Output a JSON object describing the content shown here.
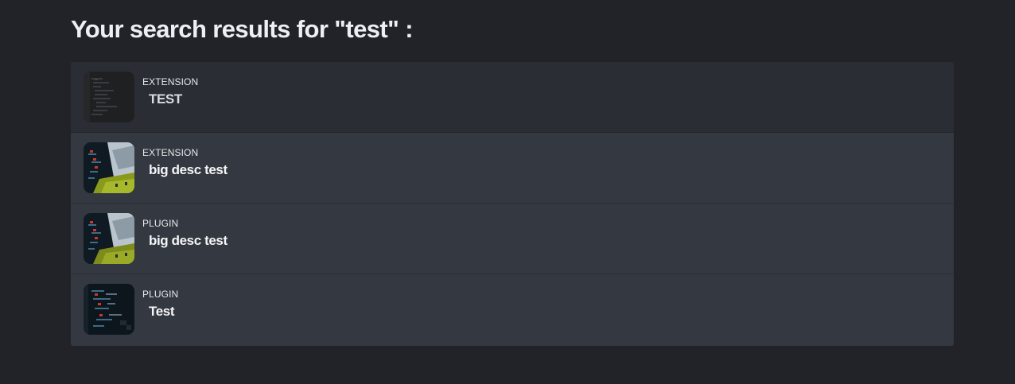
{
  "page": {
    "title": "Your search results for \"test\" :"
  },
  "results": [
    {
      "type": "EXTENSION",
      "name": "TEST",
      "thumbnail": "code-screenshot-dark-icon"
    },
    {
      "type": "EXTENSION",
      "name": "big desc test",
      "thumbnail": "code-screenshot-landscape-icon"
    },
    {
      "type": "PLUGIN",
      "name": "big desc test",
      "thumbnail": "code-screenshot-landscape-icon"
    },
    {
      "type": "PLUGIN",
      "name": "Test",
      "thumbnail": "code-screenshot-icon"
    }
  ],
  "colors": {
    "background": "#212328",
    "row": "#343840",
    "row_first": "#2a2e34",
    "text": "#f4f5f7"
  }
}
